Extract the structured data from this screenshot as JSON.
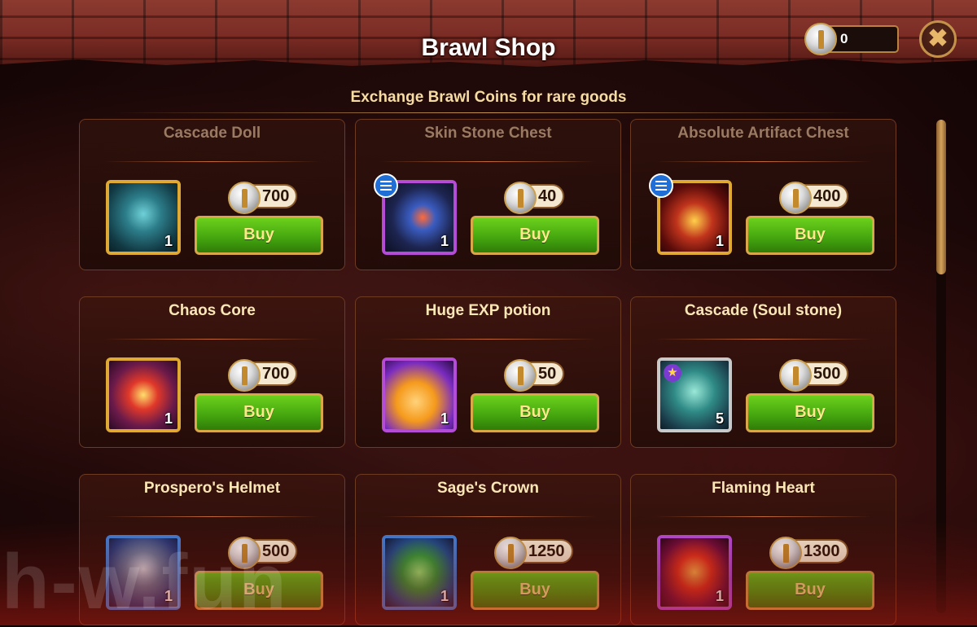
{
  "header": {
    "title": "Brawl Shop",
    "subtitle": "Exchange Brawl Coins for rare goods",
    "coins": "0"
  },
  "buttons": {
    "buy_label": "Buy",
    "close_label": "✖"
  },
  "watermark": "h-w.fun",
  "colors": {
    "buy_green": "#46a80f",
    "gold_border": "#e0a933",
    "purple_border": "#b54cd6",
    "blue_border": "#3f7fd8"
  },
  "items": [
    {
      "name": "Cascade Doll",
      "price": "700",
      "count": "1",
      "frame": "gold",
      "icon": "doll-icon",
      "faded": true
    },
    {
      "name": "Skin Stone Chest",
      "price": "40",
      "count": "1",
      "frame": "purple",
      "icon": "chest-icon",
      "faded": true
    },
    {
      "name": "Absolute Artifact Chest",
      "price": "400",
      "count": "1",
      "frame": "gold",
      "icon": "artifact-chest-icon",
      "faded": true
    },
    {
      "name": "Chaos Core",
      "price": "700",
      "count": "1",
      "frame": "gold",
      "icon": "chaos-core-icon",
      "faded": false
    },
    {
      "name": "Huge EXP potion",
      "price": "50",
      "count": "1",
      "frame": "purple",
      "icon": "potion-icon",
      "faded": false
    },
    {
      "name": "Cascade (Soul stone)",
      "price": "500",
      "count": "5",
      "frame": "silver",
      "icon": "soul-stone-icon",
      "faded": false
    },
    {
      "name": "Prospero's Helmet",
      "price": "500",
      "count": "1",
      "frame": "blue",
      "icon": "helmet-icon",
      "faded": false
    },
    {
      "name": "Sage's Crown",
      "price": "1250",
      "count": "1",
      "frame": "blue",
      "icon": "crown-icon",
      "faded": false
    },
    {
      "name": "Flaming Heart",
      "price": "1300",
      "count": "1",
      "frame": "purple",
      "icon": "heart-icon",
      "faded": false
    }
  ]
}
